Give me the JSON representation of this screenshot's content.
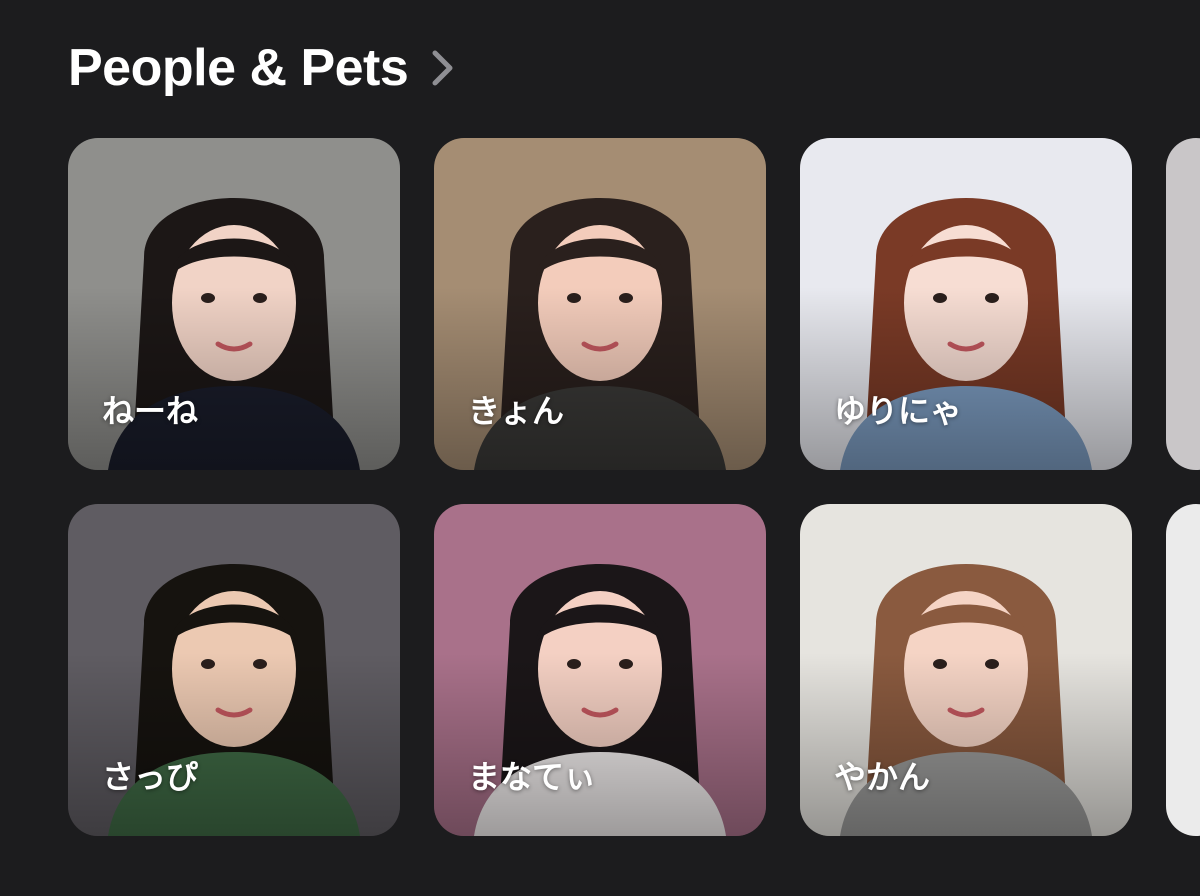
{
  "header": {
    "title": "People & Pets"
  },
  "people": [
    {
      "name": "ねーね",
      "bg": "#8f8f8c",
      "hair": "#1c1716",
      "skin": "#f1d3c6",
      "top": "#1a1d2b"
    },
    {
      "name": "きょん",
      "bg": "#a58d73",
      "hair": "#2a201d",
      "skin": "#f3ccbb",
      "top": "#3a3937"
    },
    {
      "name": "ゆりにゃ",
      "bg": "#e8e9ef",
      "hair": "#7a3a26",
      "skin": "#f7ddd3",
      "top": "#7d9dc2"
    },
    {
      "name": "さっぴ",
      "bg": "#5f5c62",
      "hair": "#16130f",
      "skin": "#ecc9b2",
      "top": "#3f6a45"
    },
    {
      "name": "まなてぃ",
      "bg": "#a9718a",
      "hair": "#1b1618",
      "skin": "#f4d0c3",
      "top": "#f2eeee"
    },
    {
      "name": "やかん",
      "bg": "#e6e4df",
      "hair": "#8a5a3f",
      "skin": "#f5d4c5",
      "top": "#9b9b9a"
    }
  ],
  "partial_cards": [
    {
      "bg": "#c9c6c8"
    },
    {
      "bg": "#ebebeb"
    }
  ],
  "colors": {
    "background": "#1c1c1e",
    "title": "#ffffff",
    "chevron": "#8e8e93"
  }
}
